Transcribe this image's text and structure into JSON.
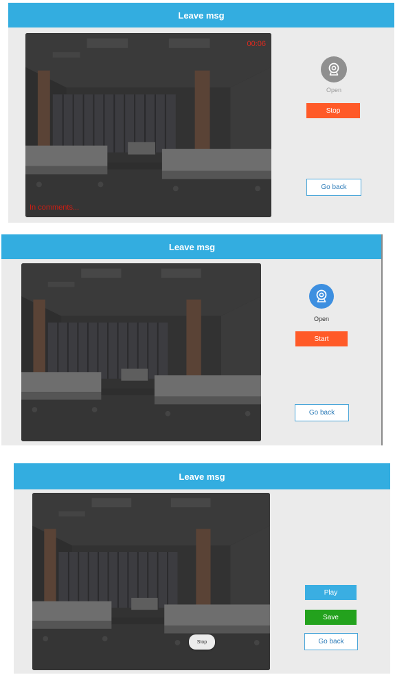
{
  "panels": [
    {
      "title": "Leave msg",
      "timer": "00:06",
      "overlay_status": "In comments...",
      "camera_label": "Open",
      "camera_state": "inactive-gray",
      "primary_button": "Stop",
      "back_button": "Go back"
    },
    {
      "title": "Leave msg",
      "camera_label": "Open",
      "camera_state": "active-blue",
      "primary_button": "Start",
      "back_button": "Go back"
    },
    {
      "title": "Leave msg",
      "video_stop_button": "Stop",
      "play_button": "Play",
      "save_button": "Save",
      "back_button": "Go back"
    }
  ],
  "colors": {
    "title_bar": "#33ade0",
    "panel_bg": "#ebebeb",
    "orange_button": "#ff5a28",
    "blue_button": "#3aaee2",
    "green_button": "#23a21d",
    "timer_red": "#e02a1e"
  }
}
